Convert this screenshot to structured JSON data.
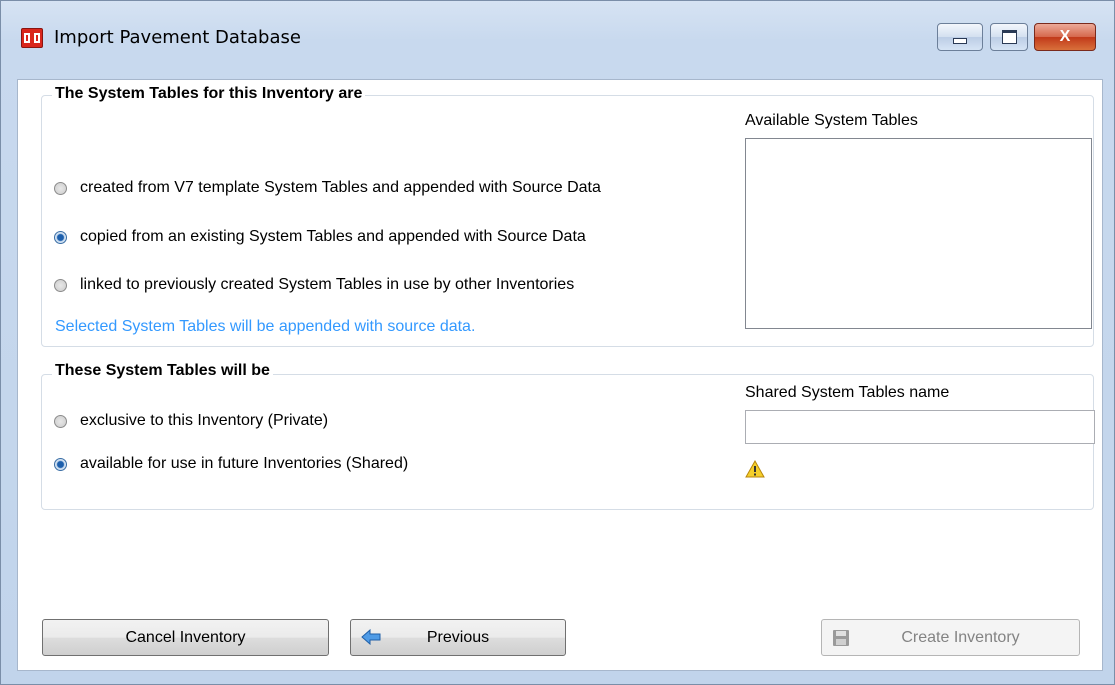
{
  "window": {
    "title": "Import Pavement Database",
    "controls": {
      "minimize": "minimize",
      "maximize": "maximize",
      "close": "X"
    }
  },
  "system_tables_group": {
    "title": "The System Tables for this Inventory are",
    "options": [
      {
        "label": "created from V7 template System Tables and appended with Source Data",
        "checked": false
      },
      {
        "label": "copied from an existing System Tables and appended with Source Data",
        "checked": true
      },
      {
        "label": "linked to previously created System Tables in use by other Inventories",
        "checked": false
      }
    ],
    "hint": "Selected System Tables will be appended with source data.",
    "available_label": "Available System Tables"
  },
  "sharing_group": {
    "title": "These System Tables will be",
    "options": [
      {
        "label": "exclusive to this Inventory (Private)",
        "checked": false
      },
      {
        "label": "available for use in future Inventories (Shared)",
        "checked": true
      }
    ],
    "shared_name_label": "Shared System Tables name",
    "shared_name_value": "",
    "warning_icon": "warning-icon"
  },
  "buttons": {
    "cancel": "Cancel Inventory",
    "previous": "Previous",
    "previous_icon": "arrow-left-icon",
    "create": "Create Inventory",
    "create_icon": "floppy-disk-icon",
    "create_enabled": false
  },
  "colors": {
    "hint_text": "#3399ff",
    "close_button": "#c1391a"
  }
}
